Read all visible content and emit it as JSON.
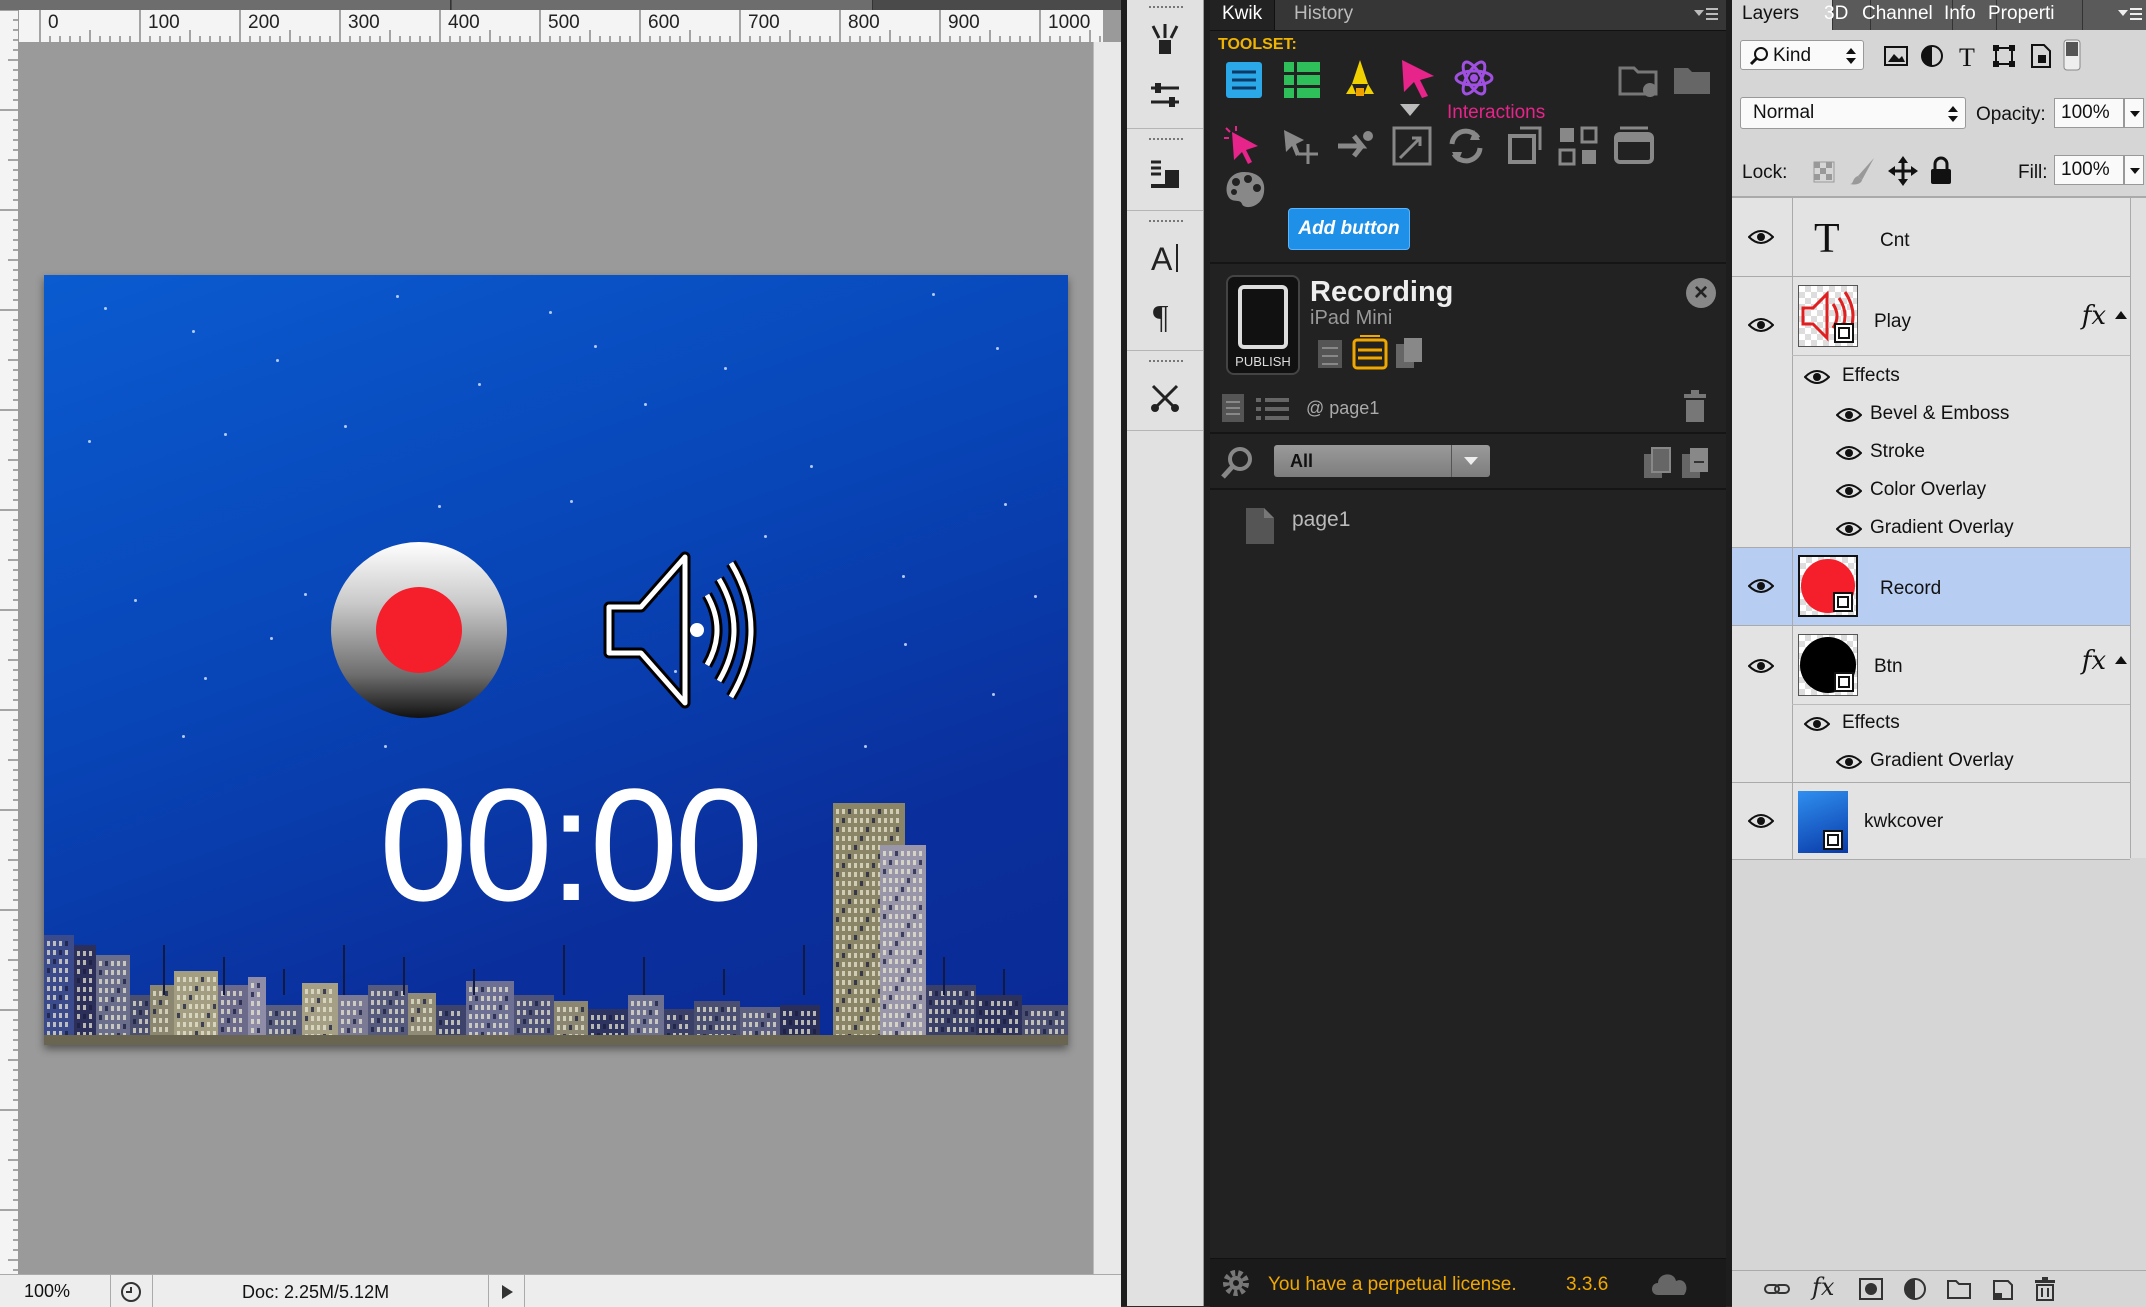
{
  "document": {
    "ruler_labels": [
      "0",
      "100",
      "200",
      "300",
      "400",
      "500",
      "600",
      "700",
      "800",
      "900",
      "1000"
    ],
    "timer": "00:00",
    "status": {
      "zoom": "100%",
      "doc_info": "Doc: 2.25M/5.12M"
    }
  },
  "kwik": {
    "tabs": [
      "Kwik",
      "History"
    ],
    "toolset_label": "TOOLSET:",
    "interactions_label": "Interactions",
    "add_button": "Add button",
    "project": {
      "title": "Recording",
      "device": "iPad Mini",
      "publish": "PUBLISH"
    },
    "page_label": "@ page1",
    "filter": "All",
    "pages": [
      "page1"
    ],
    "license": "You have a perpetual license.",
    "version": "3.3.6",
    "colors": {
      "accent": "#f0a800",
      "interactions": "#e6248a",
      "add_button": "#1e90e8"
    }
  },
  "layers": {
    "tabs": [
      "Layers",
      "3D",
      "Channel",
      "Info",
      "Properti"
    ],
    "kind": "Kind",
    "blend_mode": "Normal",
    "opacity_label": "Opacity:",
    "opacity": "100%",
    "lock_label": "Lock:",
    "fill_label": "Fill:",
    "fill": "100%",
    "items": [
      {
        "name": "Cnt"
      },
      {
        "name": "Play",
        "effects_label": "Effects",
        "effects": [
          "Bevel & Emboss",
          "Stroke",
          "Color Overlay",
          "Gradient Overlay"
        ]
      },
      {
        "name": "Record"
      },
      {
        "name": "Btn",
        "effects_label": "Effects",
        "effects": [
          "Gradient Overlay"
        ]
      },
      {
        "name": "kwkcover"
      }
    ],
    "fx": "fx"
  }
}
